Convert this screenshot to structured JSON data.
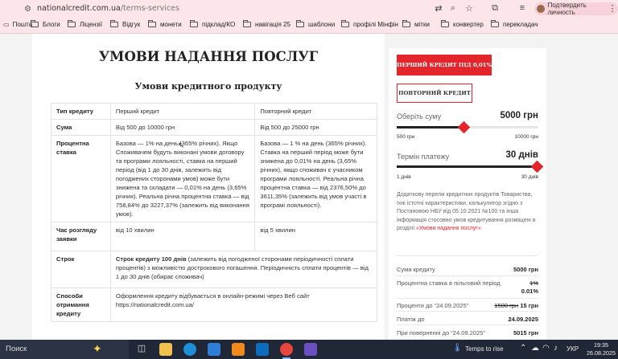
{
  "browser": {
    "url_domain": "nationalcredit.com.ua",
    "url_path": "/terms-services",
    "profile_label": "Подтвердить личность",
    "bookmarks": [
      "Пошта",
      "Блоги",
      "Ліцензії",
      "Відгук",
      "монети",
      "підклад/КО",
      "навігація 25",
      "шаблони",
      "профілі Мінфін",
      "мітки",
      "конвертер",
      "перекладач"
    ]
  },
  "page": {
    "title": "УМОВИ НАДАННЯ ПОСЛУГ",
    "subtitle": "Умови кредитного продукту",
    "table": {
      "headers": [
        "Тип кредиту",
        "Перший кредит",
        "Повторний кредит"
      ],
      "rows": [
        {
          "label": "Сума",
          "first": "Від 500 до 10000 грн",
          "repeat": "Від 500 до 25000 грн"
        },
        {
          "label": "Процентна ставка",
          "first": "Базова — 1% на день (365% річних). Якщо Споживачем будуть виконані умови договору та програми лояльності, ставка на перший період (від 1 до 30 днів, залежить від погоджених сторонами умов) може бути знижена та складати — 0,01% на день (3,65% річних). Реальна річна процентна ставка — від 758,84% до 3227,37% (залежить від виконання умов).",
          "repeat": "Базова — 1 % на день (365% річних). Ставка на перший період може бути знижена до 0,01% на день (3,65% річних), якщо споживач є учасником програми лояльності. Реальна річна процентна ставка — від 2376,50% до 3611,35% (залежить від умов участі в програмі лояльності)."
        },
        {
          "label": "Час розгляду заявки",
          "first": "від 10 хвилин",
          "repeat": "від 5 хвилин"
        },
        {
          "label": "Строк",
          "span_bold": "Строк кредиту 100 днів",
          "span_rest": " (залежить від погодженої сторонами періодичності сплати процентів) з можливістю дострокового погашення. Періодичність сплати процентів — від 1 до 30 днів (обирає споживач)"
        },
        {
          "label": "Способи отримання кредиту",
          "span": "Оформлення кредиту відбувається в онлайн-режимі через Веб сайт https://nationalcredit.com.ua/"
        }
      ]
    }
  },
  "calculator": {
    "btn_first": "ПЕРШИЙ КРЕДИТ ПІД 0,01%",
    "btn_repeat": "ПОВТОРНИЙ КРЕДИТ",
    "amount": {
      "label": "Оберіть суму",
      "value": "5000 грн",
      "min": "500 грн",
      "max": "10000 грн",
      "fraction": 0.47
    },
    "term": {
      "label": "Термін платежу",
      "value": "30 днів",
      "min": "1 днів",
      "max": "30 днів",
      "fraction": 1.0
    },
    "info_text": "Додаткову перелік кредитних продуктів Товариства, їхні істотні характеристики, калькулятор згідно з Постановою НБУ від 05.10.2021 №100 та інша інформація стосовно умов кредитування розміщені в розділі ",
    "info_link": "«Умови надання послуг»",
    "summary": [
      {
        "label": "Сума кредиту",
        "value": "5000 грн"
      },
      {
        "label": "Процентна ставка в пільговий період",
        "old": "1%",
        "value": "0.01%"
      },
      {
        "label": "Проценти до “24.09.2025”",
        "old": "1500 грн",
        "value": "15 грн"
      },
      {
        "label": "Платіж до",
        "value": "24.09.2025"
      },
      {
        "label": "При поверненні до “24.09.2025”",
        "value": "5015 грн"
      }
    ]
  },
  "taskbar": {
    "search": "Поиск",
    "weather": "Temps to rise",
    "lang": "УКР",
    "time": "19:35",
    "date": "26.08.2025"
  }
}
